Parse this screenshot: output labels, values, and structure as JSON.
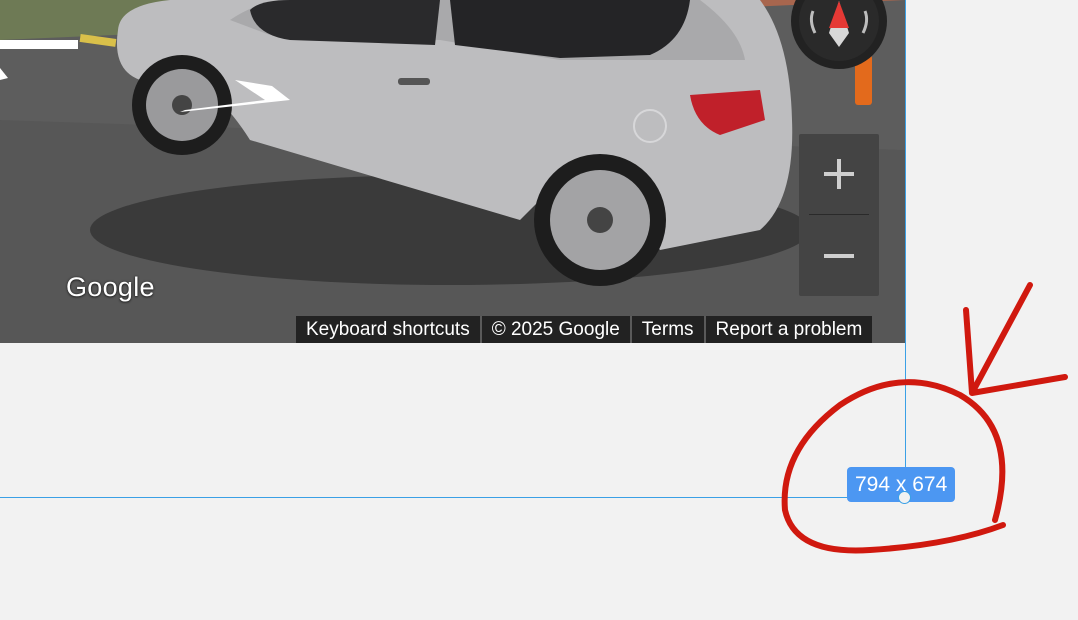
{
  "street_view": {
    "logo_text": "Google",
    "compass": {
      "icon": "compass-icon",
      "needle_color": "#e53935"
    },
    "zoom": {
      "in_icon": "plus-icon",
      "out_icon": "minus-icon"
    },
    "footer": {
      "keyboard_shortcuts": "Keyboard shortcuts",
      "copyright": "© 2025 Google",
      "terms": "Terms",
      "report": "Report a problem"
    }
  },
  "dev_overlay": {
    "size_label": "794 x 674",
    "guide_color": "#3aa0e6",
    "badge_color": "#4c97f2"
  },
  "annotation": {
    "color": "#d0190f",
    "shapes": [
      "circle",
      "arrow"
    ]
  }
}
